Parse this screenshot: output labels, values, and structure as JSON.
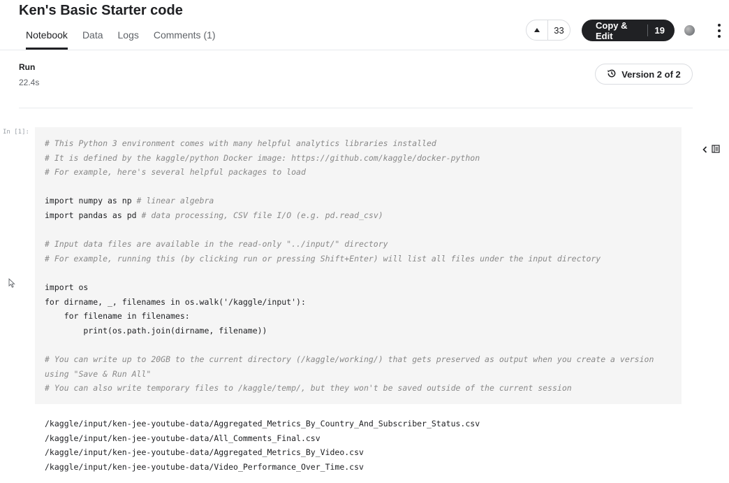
{
  "header": {
    "title": "Ken's Basic Starter code",
    "tabs": [
      {
        "label": "Notebook",
        "active": true
      },
      {
        "label": "Data",
        "active": false
      },
      {
        "label": "Logs",
        "active": false
      },
      {
        "label": "Comments (1)",
        "active": false
      }
    ],
    "vote_count": "33",
    "copy_edit_label": "Copy & Edit",
    "copy_count": "19"
  },
  "run": {
    "label": "Run",
    "time": "22.4s",
    "version_label": "Version 2 of 2"
  },
  "cell": {
    "prompt": "In [1]:",
    "lines": [
      {
        "text": "# This Python 3 environment comes with many helpful analytics libraries installed",
        "kind": "comment"
      },
      {
        "text": "# It is defined by the kaggle/python Docker image: https://github.com/kaggle/docker-python",
        "kind": "comment"
      },
      {
        "text": "# For example, here's several helpful packages to load",
        "kind": "comment"
      },
      {
        "text": "",
        "kind": "blank"
      },
      {
        "text": "import numpy as np",
        "comment": " # linear algebra",
        "kind": "mixed"
      },
      {
        "text": "import pandas as pd",
        "comment": " # data processing, CSV file I/O (e.g. pd.read_csv)",
        "kind": "mixed"
      },
      {
        "text": "",
        "kind": "blank"
      },
      {
        "text": "# Input data files are available in the read-only \"../input/\" directory",
        "kind": "comment"
      },
      {
        "text": "# For example, running this (by clicking run or pressing Shift+Enter) will list all files under the input directory",
        "kind": "comment"
      },
      {
        "text": "",
        "kind": "blank"
      },
      {
        "text": "import os",
        "kind": "code"
      },
      {
        "text": "for dirname, _, filenames in os.walk('/kaggle/input'):",
        "kind": "code"
      },
      {
        "text": "    for filename in filenames:",
        "kind": "code"
      },
      {
        "text": "        print(os.path.join(dirname, filename))",
        "kind": "code"
      },
      {
        "text": "",
        "kind": "blank"
      },
      {
        "text": "# You can write up to 20GB to the current directory (/kaggle/working/) that gets preserved as output when you create a version",
        "kind": "comment"
      },
      {
        "text": "using \"Save & Run All\"",
        "kind": "comment"
      },
      {
        "text": "# You can also write temporary files to /kaggle/temp/, but they won't be saved outside of the current session",
        "kind": "comment"
      }
    ]
  },
  "output": [
    "/kaggle/input/ken-jee-youtube-data/Aggregated_Metrics_By_Country_And_Subscriber_Status.csv",
    "/kaggle/input/ken-jee-youtube-data/All_Comments_Final.csv",
    "/kaggle/input/ken-jee-youtube-data/Aggregated_Metrics_By_Video.csv",
    "/kaggle/input/ken-jee-youtube-data/Video_Performance_Over_Time.csv"
  ]
}
